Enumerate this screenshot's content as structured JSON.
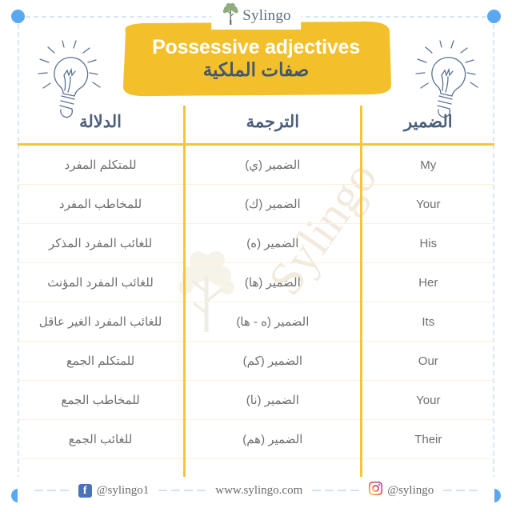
{
  "brand": {
    "name": "Sylingo",
    "logo_icon": "tree-icon"
  },
  "title": {
    "english": "Possessive adjectives",
    "arabic": "صفات الملكية",
    "banner_color": "#f3c02b",
    "english_color": "#ffffff",
    "arabic_color": "#44576f"
  },
  "decor": {
    "bulb_left_icon": "lightbulb-icon",
    "bulb_right_icon": "lightbulb-icon",
    "corner_dot_color": "#5aa9f0",
    "frame_color": "#d6e8f7"
  },
  "watermark": {
    "text": "Sylingo",
    "tree_icon": "tree-icon"
  },
  "table": {
    "headers": {
      "meaning": "الدلالة",
      "translation": "الترجمة",
      "pronoun": "الضمير"
    },
    "divider_color": "#f3c63a",
    "rows": [
      {
        "meaning": "للمتكلم المفرد",
        "translation": "الضمير (ي)",
        "pronoun": "My"
      },
      {
        "meaning": "للمخاطب المفرد",
        "translation": "الضمير (ك)",
        "pronoun": "Your"
      },
      {
        "meaning": "للغائب المفرد المذكر",
        "translation": "الضمير (ه)",
        "pronoun": "His"
      },
      {
        "meaning": "للغائب المفرد المؤنث",
        "translation": "الضمير (ها)",
        "pronoun": "Her"
      },
      {
        "meaning": "للغائب المفرد الغير عاقل",
        "translation": "الضمير (ه - ها)",
        "pronoun": "Its"
      },
      {
        "meaning": "للمتكلم الجمع",
        "translation": "الضمير (كم)",
        "pronoun": "Our"
      },
      {
        "meaning": "للمخاطب الجمع",
        "translation": "الضمير (نا)",
        "pronoun": "Your"
      },
      {
        "meaning": "للغائب الجمع",
        "translation": "الضمير (هم)",
        "pronoun": "Their"
      }
    ]
  },
  "footer": {
    "facebook_icon": "facebook-icon",
    "facebook_handle": "@sylingo1",
    "website": "www.sylingo.com",
    "instagram_icon": "instagram-icon",
    "instagram_handle": "@sylingo"
  }
}
